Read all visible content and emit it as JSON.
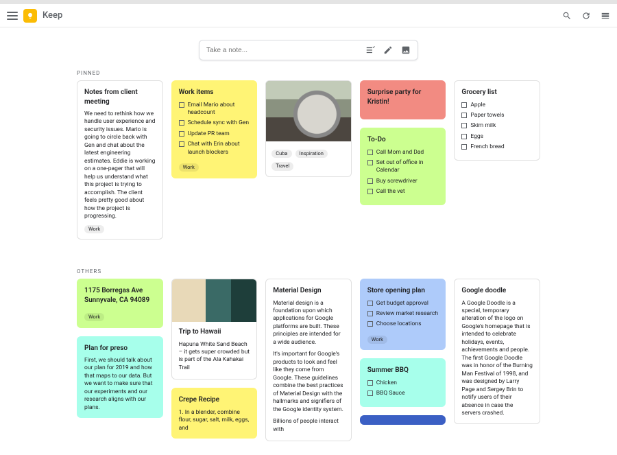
{
  "header": {
    "app_name": "Keep"
  },
  "compose": {
    "placeholder": "Take a note..."
  },
  "sections": {
    "pinned": "PINNED",
    "others": "OTHERS"
  },
  "pinned": {
    "client_notes": {
      "title": "Notes from client meeting",
      "body": "We need to rethink how we handle user experience and security issues. Mario is going to circle back with Gen and chat about the latest engineering estimates. Eddie is working on a one-pager that will help us understand what this project is trying to accomplish. The client feels pretty good about how the project is progressing.",
      "tag": "Work"
    },
    "work_items": {
      "title": "Work items",
      "items": [
        "Email Mario about headcount",
        "Schedule sync with Gen",
        "Update PR team",
        "Chat with Erin about launch blockers"
      ],
      "tag": "Work"
    },
    "car_image": {
      "tags": [
        "Cuba",
        "Inspiration",
        "Travel"
      ]
    },
    "surprise": {
      "title": "Surprise party for Kristin!"
    },
    "todo": {
      "title": "To-Do",
      "items": [
        "Call Mom and Dad",
        "Set out of office in Calendar",
        "Buy screwdriver",
        "Call the vet"
      ]
    },
    "grocery": {
      "title": "Grocery list",
      "items": [
        "Apple",
        "Paper towels",
        "Skim milk",
        "Eggs",
        "French bread"
      ]
    }
  },
  "others": {
    "address": {
      "title": "1175 Borregas Ave Sunnyvale, CA 94089",
      "tag": "Work"
    },
    "plan_preso": {
      "title": "Plan for preso",
      "body": "First, we should talk about our plan for 2019 and how that maps to our data. But we want to make sure that our experiments and our research aligns with our plans."
    },
    "hawaii": {
      "title": "Trip to Hawaii",
      "body": "Hapuna White Sand Beach – it gets super crowded but is part of the Ala Kahakai Trail"
    },
    "crepe": {
      "title": "Crepe Recipe",
      "body": "1. In a blender, combine flour, sugar, salt, milk, eggs, and"
    },
    "material": {
      "title": "Material Design",
      "p1": "Material design is a foundation upon which applications for Google platforms are built. These principles are intended for a wide audience.",
      "p2": "It's important for Google's products to look and feel like they come from Google. These guidelines combine the best practices of Material Design with the hallmarks and signifiers of the Google identity system.",
      "p3": "Billions of people interact with"
    },
    "store": {
      "title": "Store opening plan",
      "items": [
        "Get budget approval",
        "Review market research",
        "Choose locations"
      ],
      "tag": "Work"
    },
    "bbq": {
      "title": "Summer BBQ",
      "items": [
        "Chicken",
        "BBQ Sauce"
      ]
    },
    "doodle": {
      "title": "Google doodle",
      "body": "A Google Doodle is a special, temporary alteration of the logo on Google's homepage that is intended to celebrate holidays, events, achievements and people. The first Google Doodle was in honor of the Burning Man Festival of 1998, and was designed by Larry Page and Sergey Brin to notify users of their absence in case the servers crashed."
    }
  }
}
